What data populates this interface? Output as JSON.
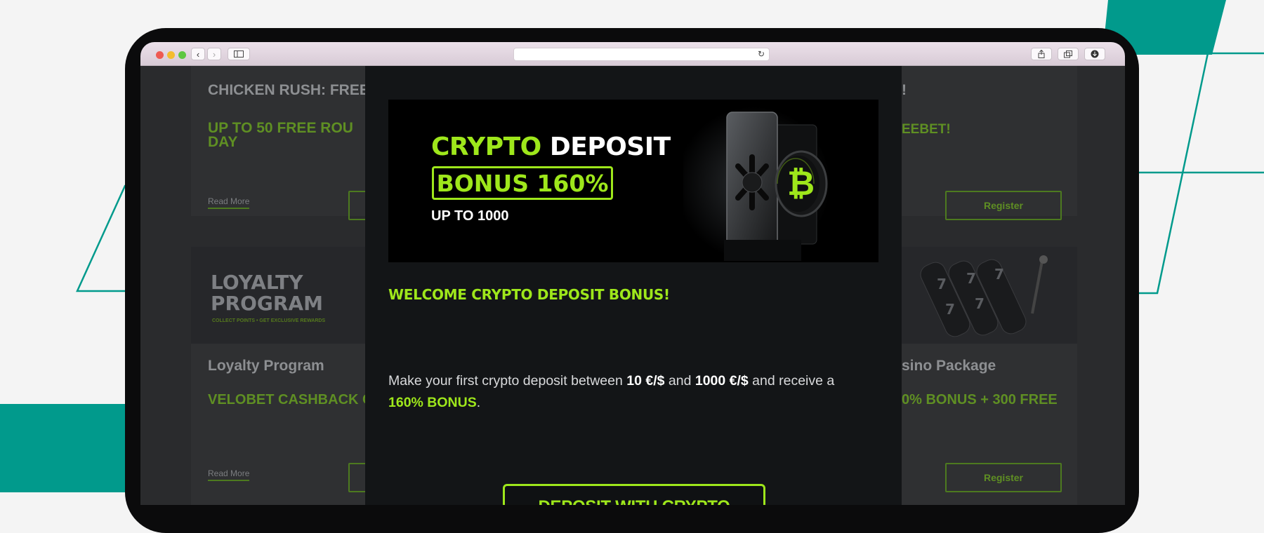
{
  "colors": {
    "accent_teal": "#019a8c",
    "accent_lime": "#9ee71b",
    "modal_bg": "#131517"
  },
  "browser": {
    "back_icon": "chevron-left-icon",
    "forward_icon": "chevron-right-icon",
    "sidebar_icon": "sidebar-icon",
    "reload_icon": "reload-icon",
    "share_icon": "share-icon",
    "tabs_icon": "tabs-icon",
    "download_icon": "download-icon"
  },
  "background": {
    "cards": [
      {
        "title": "CHICKEN RUSH: FREE",
        "green": [
          "UP TO 50 FREE ROU",
          "DAY"
        ],
        "read_more": "Read More"
      },
      {
        "title": "!",
        "green": [
          "EEBET!"
        ],
        "register": "Register"
      },
      {
        "banner_title": [
          "LOYALTY",
          "PROGRAM"
        ],
        "banner_sub": "COLLECT POINTS • GET EXCLUSIVE REWARDS",
        "title": "Loyalty Program",
        "green": [
          "VELOBET CASHBACK C"
        ],
        "read_more": "Read More"
      },
      {
        "title": "sino Package",
        "green": [
          "0% BONUS + 300 FREE"
        ],
        "register": "Register"
      }
    ]
  },
  "modal": {
    "banner": {
      "line1_green": "CRYPTO",
      "line1_white": "DEPOSIT",
      "bonus": "BONUS 160%",
      "upto": "UP TO 1000",
      "coin_icon": "bitcoin-icon"
    },
    "heading": "WELCOME CRYPTO DEPOSIT BONUS!",
    "text": {
      "part1": "Make your first crypto deposit between ",
      "amount1": "10 €/$",
      "part2": " and ",
      "amount2": "1000 €/$",
      "part3": " and receive a ",
      "bonus": "160% BONUS",
      "part4": "."
    },
    "button": "DEPOSIT WITH CRYPTO"
  }
}
